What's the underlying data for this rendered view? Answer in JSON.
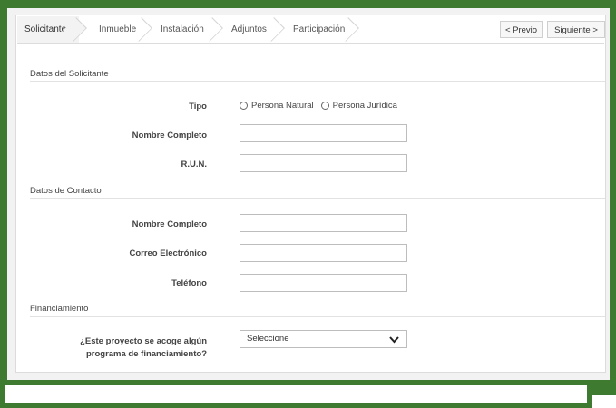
{
  "tabs": [
    {
      "label": "Solicitante",
      "active": true
    },
    {
      "label": "Inmueble",
      "active": false
    },
    {
      "label": "Instalación",
      "active": false
    },
    {
      "label": "Adjuntos",
      "active": false
    },
    {
      "label": "Participación",
      "active": false
    }
  ],
  "nav": {
    "prev": "< Previo",
    "next": "Siguiente >"
  },
  "solicitante": {
    "section_title": "Datos del Solicitante",
    "tipo_label": "Tipo",
    "tipo_options": [
      "Persona Natural",
      "Persona Jurídica"
    ],
    "nombre_label": "Nombre Completo",
    "nombre_value": "",
    "run_label": "R.U.N.",
    "run_value": ""
  },
  "contacto": {
    "section_title": "Datos de Contacto",
    "nombre_label": "Nombre Completo",
    "correo_label": "Correo Electrónico",
    "telefono_label": "Teléfono"
  },
  "financiamiento": {
    "section_title": "Financiamiento",
    "question_line1": "¿Este proyecto se acoge algún",
    "question_line2": "programa de financiamiento?",
    "select_value": "Seleccione"
  },
  "colors": {
    "frame": "#3e7a2f",
    "border": "#dcdcdc"
  }
}
